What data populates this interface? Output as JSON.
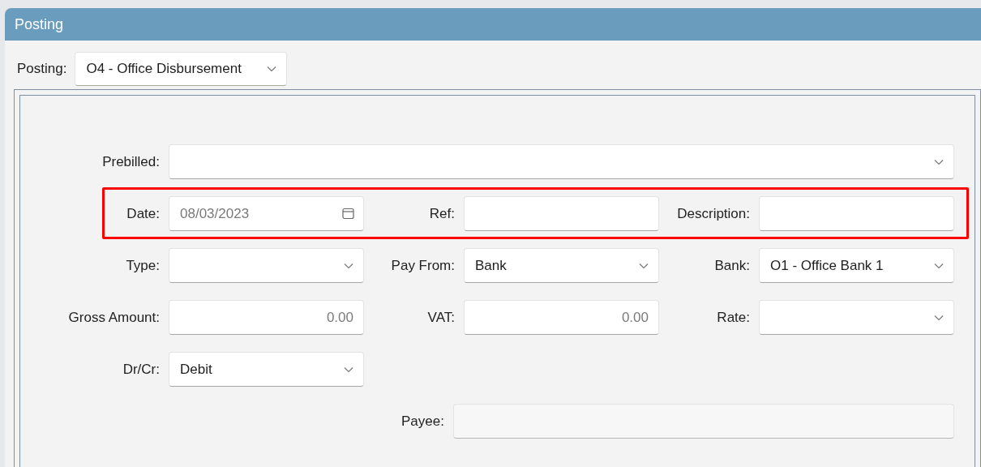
{
  "window": {
    "title": "Posting"
  },
  "posting": {
    "label": "Posting:",
    "value": "O4 - Office Disbursement"
  },
  "rows": [
    {
      "kind": "wide",
      "highlighted": false,
      "fields": [
        {
          "label": "Prebilled:",
          "kind": "dropdown",
          "disabled": false
        }
      ]
    },
    {
      "kind": "grid",
      "highlighted": true,
      "fields": [
        {
          "label": "Date:",
          "kind": "date",
          "placeholder": "08/03/2023",
          "disabled": false
        },
        {
          "label": "Ref:",
          "kind": "text",
          "disabled": false
        },
        {
          "label": "Description:",
          "kind": "text",
          "disabled": false
        }
      ]
    },
    {
      "kind": "grid",
      "highlighted": false,
      "fields": [
        {
          "label": "Type:",
          "kind": "dropdown",
          "disabled": false
        },
        {
          "label": "Pay From:",
          "kind": "dropdown",
          "value": "Bank",
          "disabled": false
        },
        {
          "label": "Bank:",
          "kind": "dropdown",
          "value": "O1 - Office Bank 1",
          "disabled": false
        }
      ]
    },
    {
      "kind": "grid",
      "highlighted": false,
      "fields": [
        {
          "label": "Gross Amount:",
          "kind": "number",
          "placeholder": "0.00",
          "disabled": false
        },
        {
          "label": "VAT:",
          "kind": "number",
          "placeholder": "0.00",
          "disabled": false
        },
        {
          "label": "Rate:",
          "kind": "dropdown",
          "disabled": false
        }
      ]
    },
    {
      "kind": "grid",
      "highlighted": false,
      "fields": [
        {
          "label": "Dr/Cr:",
          "kind": "dropdown",
          "value": "Debit",
          "disabled": false
        }
      ]
    },
    {
      "kind": "offset",
      "highlighted": false,
      "fields": [
        {
          "label": "Payee:",
          "kind": "text",
          "disabled": true
        }
      ]
    }
  ]
}
